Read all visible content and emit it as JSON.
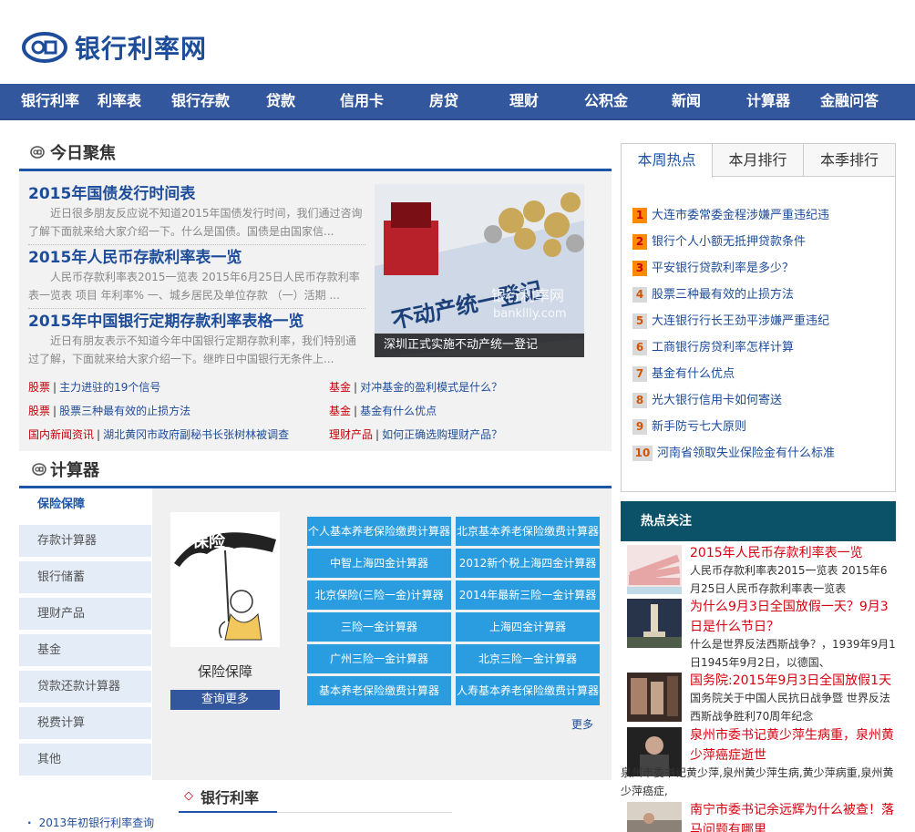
{
  "header": {
    "logo_text": "银行利率网"
  },
  "nav": [
    "银行利率",
    "利率表",
    "银行存款",
    "贷款",
    "信用卡",
    "房贷",
    "理财",
    "公积金",
    "新闻",
    "计算器",
    "金融问答"
  ],
  "focus": {
    "title": "今日聚焦",
    "articles": [
      {
        "title": "2015年国债发行时间表",
        "summary": "近日很多朋友反应说不知道2015年国债发行时间，我们通过咨询了解下面就来给大家介绍一下。什么是国债。国债是由国家信..."
      },
      {
        "title": "2015年人民币存款利率表一览",
        "summary": "人民币存款利率表2015一览表 2015年6月25日人民币存款利率表一览表 项目 年利率% 一、城乡居民及单位存款 （一）活期 ..."
      },
      {
        "title": "2015年中国银行定期存款利率表格一览",
        "summary": "近日有朋友表示不知道今年中国银行定期存款利率，我们特别通过了解，下面就来给大家介绍一下。继昨日中国银行无条件上..."
      }
    ],
    "photo_caption": "深圳正式实施不动产统一登记",
    "photo_watermark": "银行利率网",
    "photo_watermark_sub": "bankllly.com",
    "photo_banner_text": "不动产统一登记",
    "links": [
      {
        "cat": "股票",
        "text": "主力进驻的19个信号"
      },
      {
        "cat": "基金",
        "text": "对冲基金的盈利模式是什么？"
      },
      {
        "cat": "股票",
        "text": "股票三种最有效的止损方法"
      },
      {
        "cat": "基金",
        "text": "基金有什么优点"
      },
      {
        "cat": "国内新闻资讯",
        "text": "湖北黄冈市政府副秘书长张树林被调查"
      },
      {
        "cat": "理财产品",
        "text": "如何正确选购理财产品？"
      }
    ]
  },
  "calculator": {
    "title": "计算器",
    "menu": [
      "保险保障",
      "存款计算器",
      "银行储蓄",
      "理财产品",
      "基金",
      "贷款还款计算器",
      "税费计算",
      "其他"
    ],
    "insurance_label": "保险保障",
    "insurance_img_text": "保险",
    "insurance_button": "查询更多",
    "buttons": [
      "个人基本养老保险缴费计算器",
      "北京基本养老保险缴费计算器",
      "中智上海四金计算器",
      "2012新个税上海四金计算器",
      "北京保险(三险一金)计算器",
      "2014年最新三险一金计算器",
      "三险一金计算器",
      "上海四金计算器",
      "广州三险一金计算器",
      "北京三险一金计算器",
      "基本养老保险缴费计算器",
      "人寿基本养老保险缴费计算器"
    ],
    "more": "更多"
  },
  "bank_rate": {
    "title": "银行利率",
    "links": [
      "2013年初银行利率查询"
    ]
  },
  "ranking": {
    "tabs": [
      "本周热点",
      "本月排行",
      "本季排行"
    ],
    "items": [
      {
        "num": "1",
        "text": "大连市委常委金程涉嫌严重违纪违"
      },
      {
        "num": "2",
        "text": "银行个人小额无抵押贷款条件"
      },
      {
        "num": "3",
        "text": "平安银行贷款利率是多少？"
      },
      {
        "num": "4",
        "text": "股票三种最有效的止损方法"
      },
      {
        "num": "5",
        "text": "大连银行行长王劲平涉嫌严重违纪"
      },
      {
        "num": "6",
        "text": "工商银行房贷利率怎样计算"
      },
      {
        "num": "7",
        "text": "基金有什么优点"
      },
      {
        "num": "8",
        "text": "光大银行信用卡如何寄送"
      },
      {
        "num": "9",
        "text": "新手防亏七大原则"
      },
      {
        "num": "10",
        "text": "河南省领取失业保险金有什么标准"
      }
    ],
    "colors": {
      "top": "#ff8a00",
      "other": "#d9d9d9",
      "top_text": "#c8000a",
      "other_text": "#d35400"
    }
  },
  "hot": {
    "title": "热点关注",
    "items": [
      {
        "title": "2015年人民币存款利率表一览",
        "desc": "人民币存款利率表2015一览表 2015年6月25日人民币存款利率表一览表"
      },
      {
        "title": "为什么9月3日全国放假一天？9月3日是什么节日？",
        "desc": "什么是世界反法西斯战争？，1939年9月1日1945年9月2日，以德国、"
      },
      {
        "title": "国务院:2015年9月3日全国放假1天",
        "desc": "国务院关于中国人民抗日战争暨 世界反法西斯战争胜利70周年纪念"
      },
      {
        "title": "泉州市委书记黄少萍生病重，泉州黄少萍癌症逝世",
        "desc": "泉州市委书记黄少萍,泉州黄少萍生病,黄少萍病重,泉州黄少萍癌症,"
      },
      {
        "title": "南宁市委书记余远辉为什么被查！落马问题有哪里",
        "desc": ""
      }
    ]
  }
}
